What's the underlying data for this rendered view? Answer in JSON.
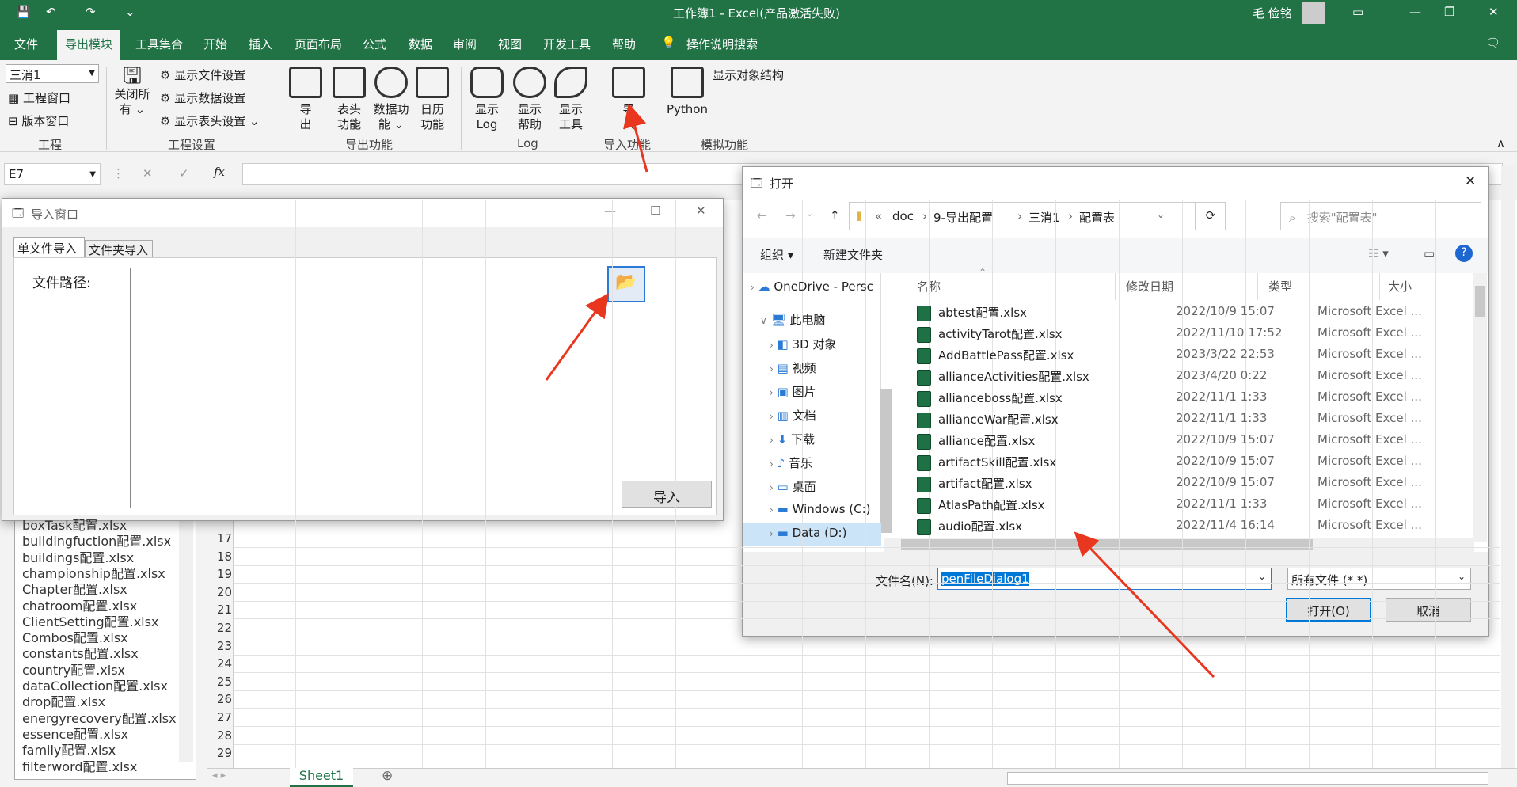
{
  "titlebar": {
    "title": "工作簿1 - Excel(产品激活失败)",
    "user": "毛 俭铭"
  },
  "tabs": [
    "文件",
    "导出模块",
    "工具集合",
    "开始",
    "插入",
    "页面布局",
    "公式",
    "数据",
    "审阅",
    "视图",
    "开发工具",
    "帮助"
  ],
  "search_hint": "操作说明搜索",
  "ribbon": {
    "project_dropdown": "三消1",
    "project_window": "工程窗口",
    "version_window": "版本窗口",
    "group_project": "工程",
    "close_all_line1": "关闭所",
    "close_all_line2": "有",
    "show_file": "显示文件设置",
    "show_data": "显示数据设置",
    "show_header": "显示表头设置",
    "group_settings": "工程设置",
    "export_1": "导",
    "export_2": "出",
    "header_1": "表头",
    "header_2": "功能",
    "data_1": "数据功",
    "data_2": "能",
    "cal_1": "日历",
    "cal_2": "功能",
    "group_export": "导出功能",
    "log_1": "显示",
    "log_2": "Log",
    "help_1": "显示",
    "help_2": "帮助",
    "tool_1": "显示",
    "tool_2": "工具",
    "group_log": "Log",
    "import_1": "导",
    "import_2": "入",
    "group_import": "导入功能",
    "python": "Python",
    "show_obj": "显示对象结构",
    "group_sim": "模拟功能"
  },
  "formula": {
    "namebox": "E7",
    "fx": "fx"
  },
  "rows": [
    "17",
    "18",
    "19",
    "20",
    "21",
    "22",
    "23",
    "24",
    "25",
    "26",
    "27",
    "28",
    "29"
  ],
  "sidebar_files": [
    "boxTask配置.xlsx",
    "buildingfuction配置.xlsx",
    "buildings配置.xlsx",
    "championship配置.xlsx",
    "Chapter配置.xlsx",
    "chatroom配置.xlsx",
    "ClientSetting配置.xlsx",
    "Combos配置.xlsx",
    "constants配置.xlsx",
    "country配置.xlsx",
    "dataCollection配置.xlsx",
    "drop配置.xlsx",
    "energyrecovery配置.xlsx",
    "essence配置.xlsx",
    "family配置.xlsx",
    "filterword配置.xlsx"
  ],
  "sheet_tab": "Sheet1",
  "import_win": {
    "title": "导入窗口",
    "tab1": "单文件导入",
    "tab2": "文件夹导入",
    "path_label": "文件路径:",
    "import_btn": "导入"
  },
  "open_dlg": {
    "title": "打开",
    "crumbs": [
      "«",
      "doc",
      "9-导出配置",
      "三消1",
      "配置表"
    ],
    "search_placeholder": "搜索\"配置表\"",
    "organize": "组织",
    "new_folder": "新建文件夹",
    "col_name": "名称",
    "col_date": "修改日期",
    "col_type": "类型",
    "col_size": "大小",
    "tree": [
      "OneDrive - Persc",
      "此电脑",
      "3D 对象",
      "视频",
      "图片",
      "文档",
      "下载",
      "音乐",
      "桌面",
      "Windows (C:)",
      "Data (D:)"
    ],
    "files": [
      {
        "name": "abtest配置.xlsx",
        "date": "2022/10/9 15:07",
        "type": "Microsoft Excel ..."
      },
      {
        "name": "activityTarot配置.xlsx",
        "date": "2022/11/10 17:52",
        "type": "Microsoft Excel ..."
      },
      {
        "name": "AddBattlePass配置.xlsx",
        "date": "2023/3/22 22:53",
        "type": "Microsoft Excel ..."
      },
      {
        "name": "allianceActivities配置.xlsx",
        "date": "2023/4/20 0:22",
        "type": "Microsoft Excel ..."
      },
      {
        "name": "allianceboss配置.xlsx",
        "date": "2022/11/1 1:33",
        "type": "Microsoft Excel ..."
      },
      {
        "name": "allianceWar配置.xlsx",
        "date": "2022/11/1 1:33",
        "type": "Microsoft Excel ..."
      },
      {
        "name": "alliance配置.xlsx",
        "date": "2022/10/9 15:07",
        "type": "Microsoft Excel ..."
      },
      {
        "name": "artifactSkill配置.xlsx",
        "date": "2022/10/9 15:07",
        "type": "Microsoft Excel ..."
      },
      {
        "name": "artifact配置.xlsx",
        "date": "2022/10/9 15:07",
        "type": "Microsoft Excel ..."
      },
      {
        "name": "AtlasPath配置.xlsx",
        "date": "2022/11/1 1:33",
        "type": "Microsoft Excel ..."
      },
      {
        "name": "audio配置.xlsx",
        "date": "2022/11/4 16:14",
        "type": "Microsoft Excel ..."
      }
    ],
    "filename_label": "文件名(N):",
    "filename_value": "penFileDialog1",
    "filter": "所有文件 (*.*)",
    "open_btn": "打开(O)",
    "cancel_btn": "取消"
  }
}
